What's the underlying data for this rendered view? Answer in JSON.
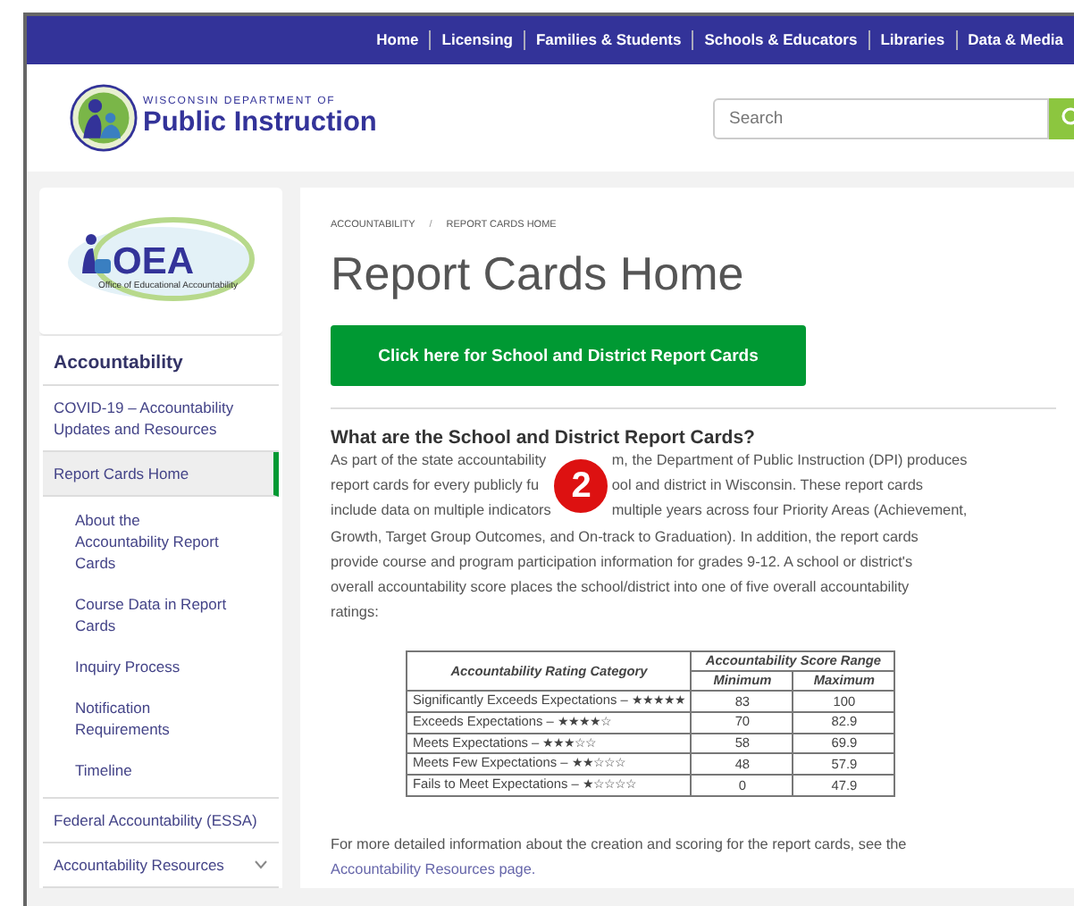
{
  "top_nav": [
    "Home",
    "Licensing",
    "Families & Students",
    "Schools & Educators",
    "Libraries",
    "Data & Media"
  ],
  "header": {
    "logo_small": "WISCONSIN DEPARTMENT OF",
    "logo_big": "Public Instruction",
    "search": {
      "placeholder": "Search"
    }
  },
  "sidebar": {
    "logo": {
      "big": "OEA",
      "small": "Office of Educational Accountability"
    },
    "title": "Accountability",
    "items": [
      {
        "label": "COVID-19 – Accountability Updates and Resources",
        "selected": false
      },
      {
        "label": "Report Cards Home",
        "selected": true,
        "children": [
          {
            "label": "About the Accountability Report Cards"
          },
          {
            "label": "Course Data in Report Cards"
          },
          {
            "label": "Inquiry Process"
          },
          {
            "label": "Notification Requirements"
          },
          {
            "label": "Timeline"
          }
        ]
      },
      {
        "label": "Federal Accountability (ESSA)",
        "selected": false
      },
      {
        "label": "Accountability Resources",
        "selected": false,
        "expandable": true
      }
    ]
  },
  "breadcrumb": [
    "ACCOUNTABILITY",
    "REPORT CARDS HOME"
  ],
  "breadcrumb_separator": "/",
  "title": "Report Cards Home",
  "cta_button": "Click here for School and District Report Cards",
  "section_heading": "What are the School and District Report Cards?",
  "badge": "2",
  "covered_lines": [
    {
      "before": "As part of the state accountability",
      "after": "m, the Department of Public Instruction (DPI) produces"
    },
    {
      "before": "report cards for every publicly fu",
      "after": "ool and district in Wisconsin. These report cards"
    },
    {
      "before": "include data on multiple indicators",
      "after": "multiple years across four Priority Areas (Achievement,"
    }
  ],
  "lines": [
    "Growth, Target Group Outcomes, and On-track to Graduation). In addition, the report cards",
    "provide course and program participation information for grades 9-12. A school or district's",
    "overall accountability score places the school/district into one of five overall accountability",
    "ratings:"
  ],
  "table": {
    "category_header": "Accountability Rating Category",
    "range_header": "Accountability Score Range",
    "columns": [
      "Minimum",
      "Maximum"
    ],
    "rows": [
      {
        "category": "Significantly Exceeds Expectations –",
        "stars": 5,
        "minimum": "83",
        "maximum": "100"
      },
      {
        "category": "Exceeds Expectations –",
        "stars": 4,
        "minimum": "70",
        "maximum": "82.9"
      },
      {
        "category": "Meets Expectations –",
        "stars": 3,
        "minimum": "58",
        "maximum": "69.9"
      },
      {
        "category": "Meets Few Expectations –",
        "stars": 2,
        "minimum": "48",
        "maximum": "57.9"
      },
      {
        "category": "Fails to Meet Expectations –",
        "stars": 1,
        "minimum": "0",
        "maximum": "47.9"
      }
    ]
  },
  "footer_text": "For more detailed information about the creation and scoring for the report cards, see the",
  "footer_link": "Accountability Resources page."
}
